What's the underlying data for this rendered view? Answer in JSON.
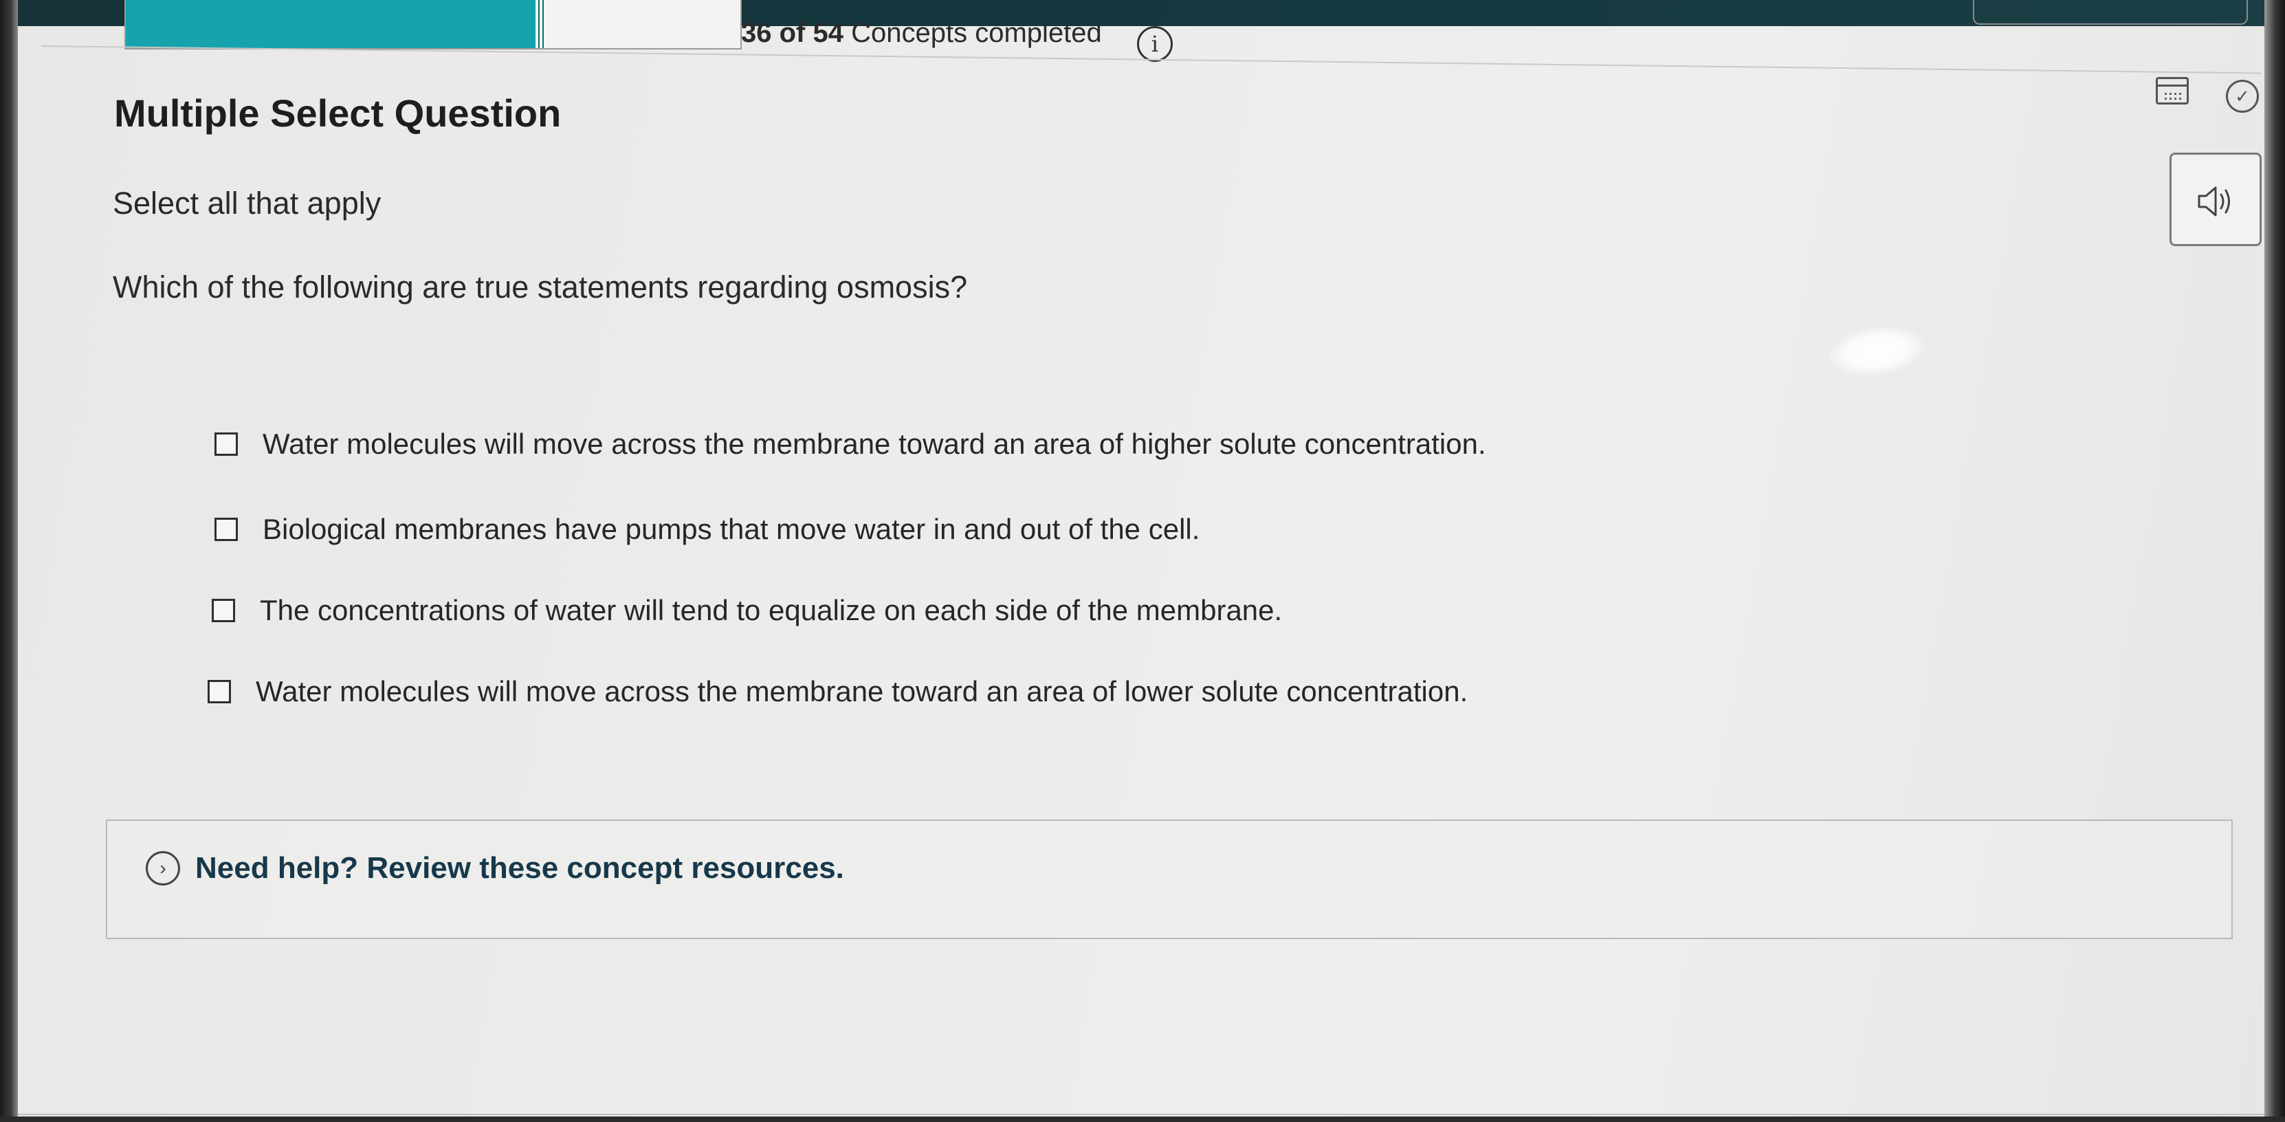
{
  "header": {
    "progress": {
      "completed": 36,
      "total": 54,
      "fraction": 0.667
    },
    "completed_count": "36",
    "of_label": "of",
    "total_count": "54",
    "suffix": "Concepts completed",
    "info_icon": "info-circle-icon"
  },
  "question": {
    "type_title": "Multiple Select Question",
    "instruction": "Select all that apply",
    "prompt": "Which of the following are true statements regarding osmosis?",
    "options": [
      {
        "label": "Water molecules will move across the membrane toward an area of higher solute concentration.",
        "checked": false
      },
      {
        "label": "Biological membranes have pumps that move water in and out of the cell.",
        "checked": false
      },
      {
        "label": "The concentrations of water will tend to equalize on each side of the membrane.",
        "checked": false
      },
      {
        "label": "Water molecules will move across the membrane toward an area of lower solute concentration.",
        "checked": false
      }
    ]
  },
  "help": {
    "label": "Need help? Review these concept resources.",
    "icon": "chevron-right-circle-icon"
  },
  "toolbar": {
    "calendar_icon": "calendar-icon",
    "check_icon": "check-circle-icon",
    "audio_icon": "speaker-icon"
  },
  "colors": {
    "header_bg": "#16333a",
    "progress_fill": "#17a3ad",
    "help_text": "#17384a"
  }
}
